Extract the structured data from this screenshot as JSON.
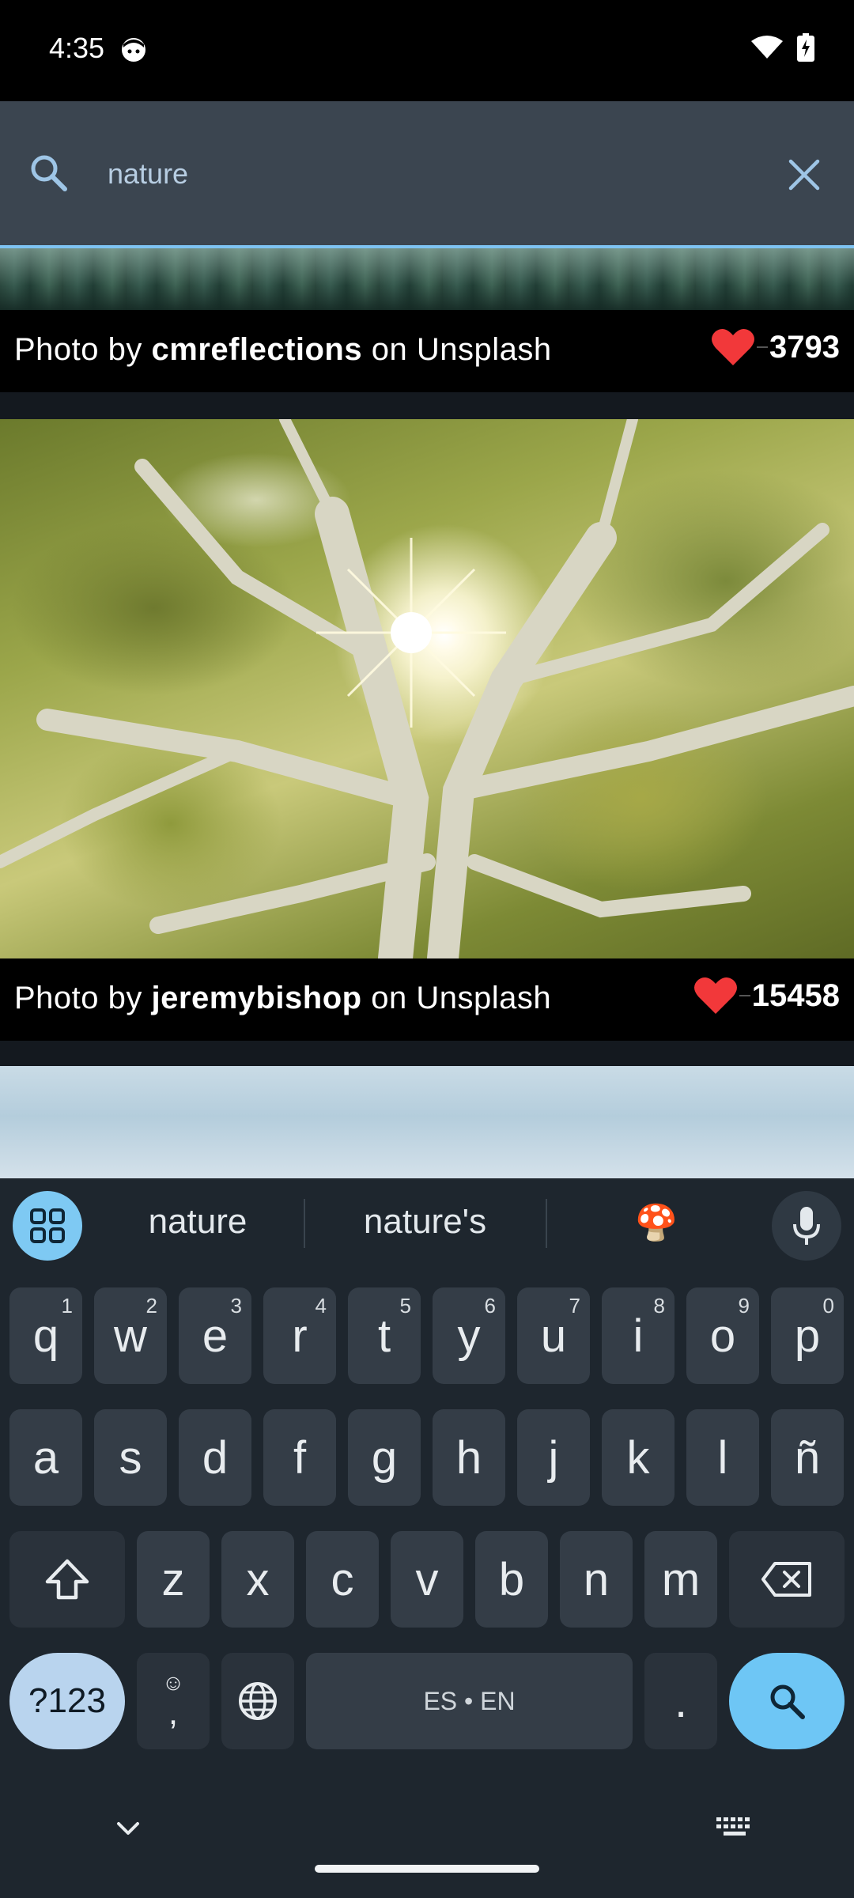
{
  "status_bar": {
    "time": "4:35"
  },
  "search": {
    "query": "nature",
    "placeholder": ""
  },
  "feed": {
    "photos": [
      {
        "prefix": "Photo by ",
        "author": "cmreflections",
        "suffix": " on Unsplash",
        "likes": "3793"
      },
      {
        "prefix": "Photo by ",
        "author": "jeremybishop",
        "suffix": " on Unsplash",
        "likes": "15458"
      }
    ]
  },
  "keyboard": {
    "suggestions": [
      "nature",
      "nature's",
      "🍄"
    ],
    "row1": [
      {
        "key": "q",
        "hint": "1"
      },
      {
        "key": "w",
        "hint": "2"
      },
      {
        "key": "e",
        "hint": "3"
      },
      {
        "key": "r",
        "hint": "4"
      },
      {
        "key": "t",
        "hint": "5"
      },
      {
        "key": "y",
        "hint": "6"
      },
      {
        "key": "u",
        "hint": "7"
      },
      {
        "key": "i",
        "hint": "8"
      },
      {
        "key": "o",
        "hint": "9"
      },
      {
        "key": "p",
        "hint": "0"
      }
    ],
    "row2": [
      "a",
      "s",
      "d",
      "f",
      "g",
      "h",
      "j",
      "k",
      "l",
      "ñ"
    ],
    "row3": [
      "z",
      "x",
      "c",
      "v",
      "b",
      "n",
      "m"
    ],
    "mode_label": "?123",
    "emoji_comma_top": "☺",
    "comma": ",",
    "space_label": "ES • EN",
    "period": "."
  },
  "colors": {
    "accent": "#7ec3f2",
    "heart": "#f2383a",
    "search_key": "#6ec6f5"
  }
}
